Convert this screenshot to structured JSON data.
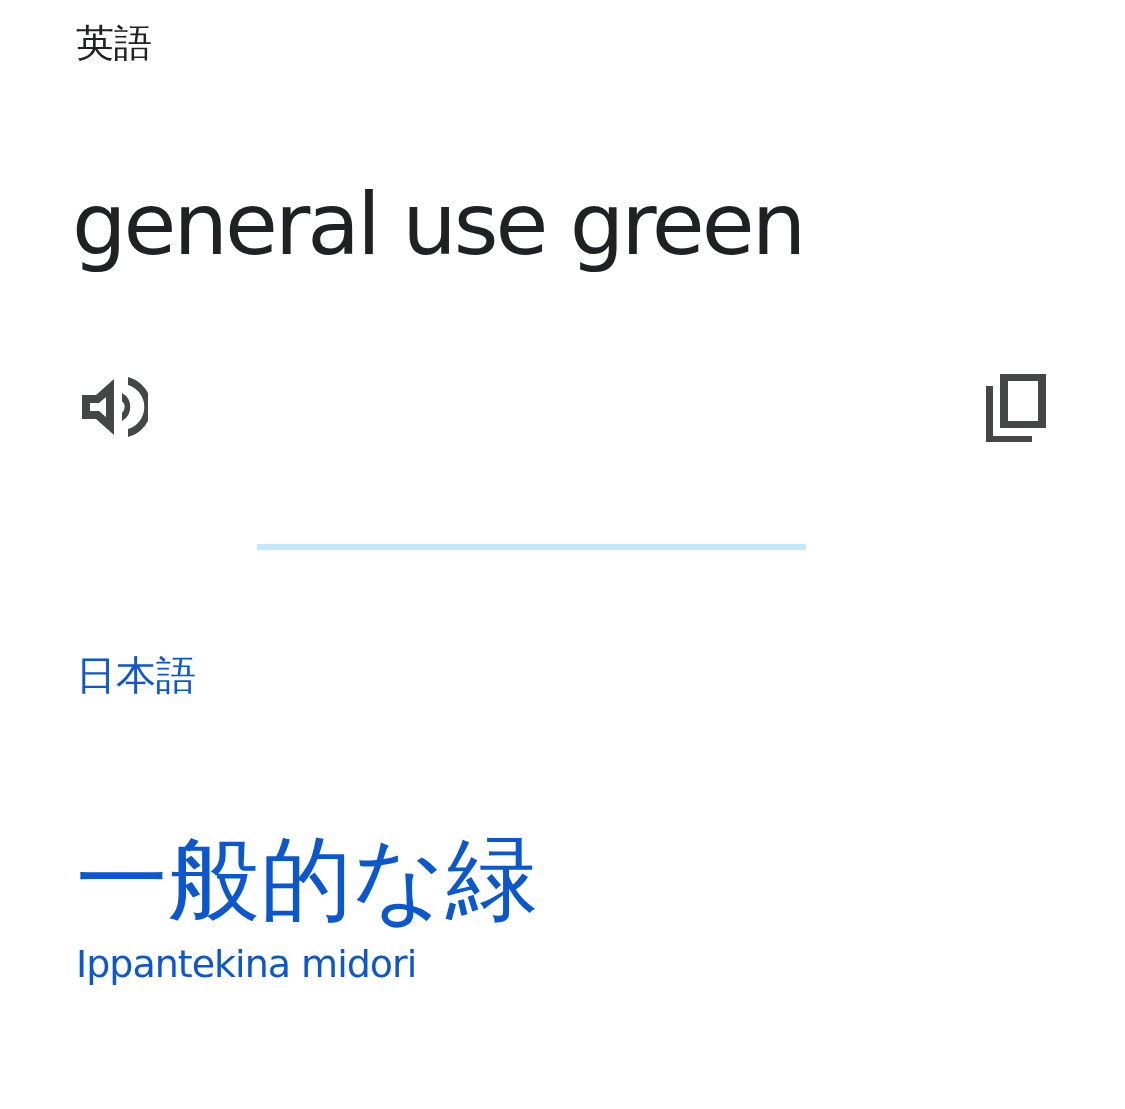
{
  "source": {
    "language": "英語",
    "text": "general use green"
  },
  "target": {
    "language": "日本語",
    "text": "一般的な緑",
    "romanization": "Ippantekina midori"
  }
}
